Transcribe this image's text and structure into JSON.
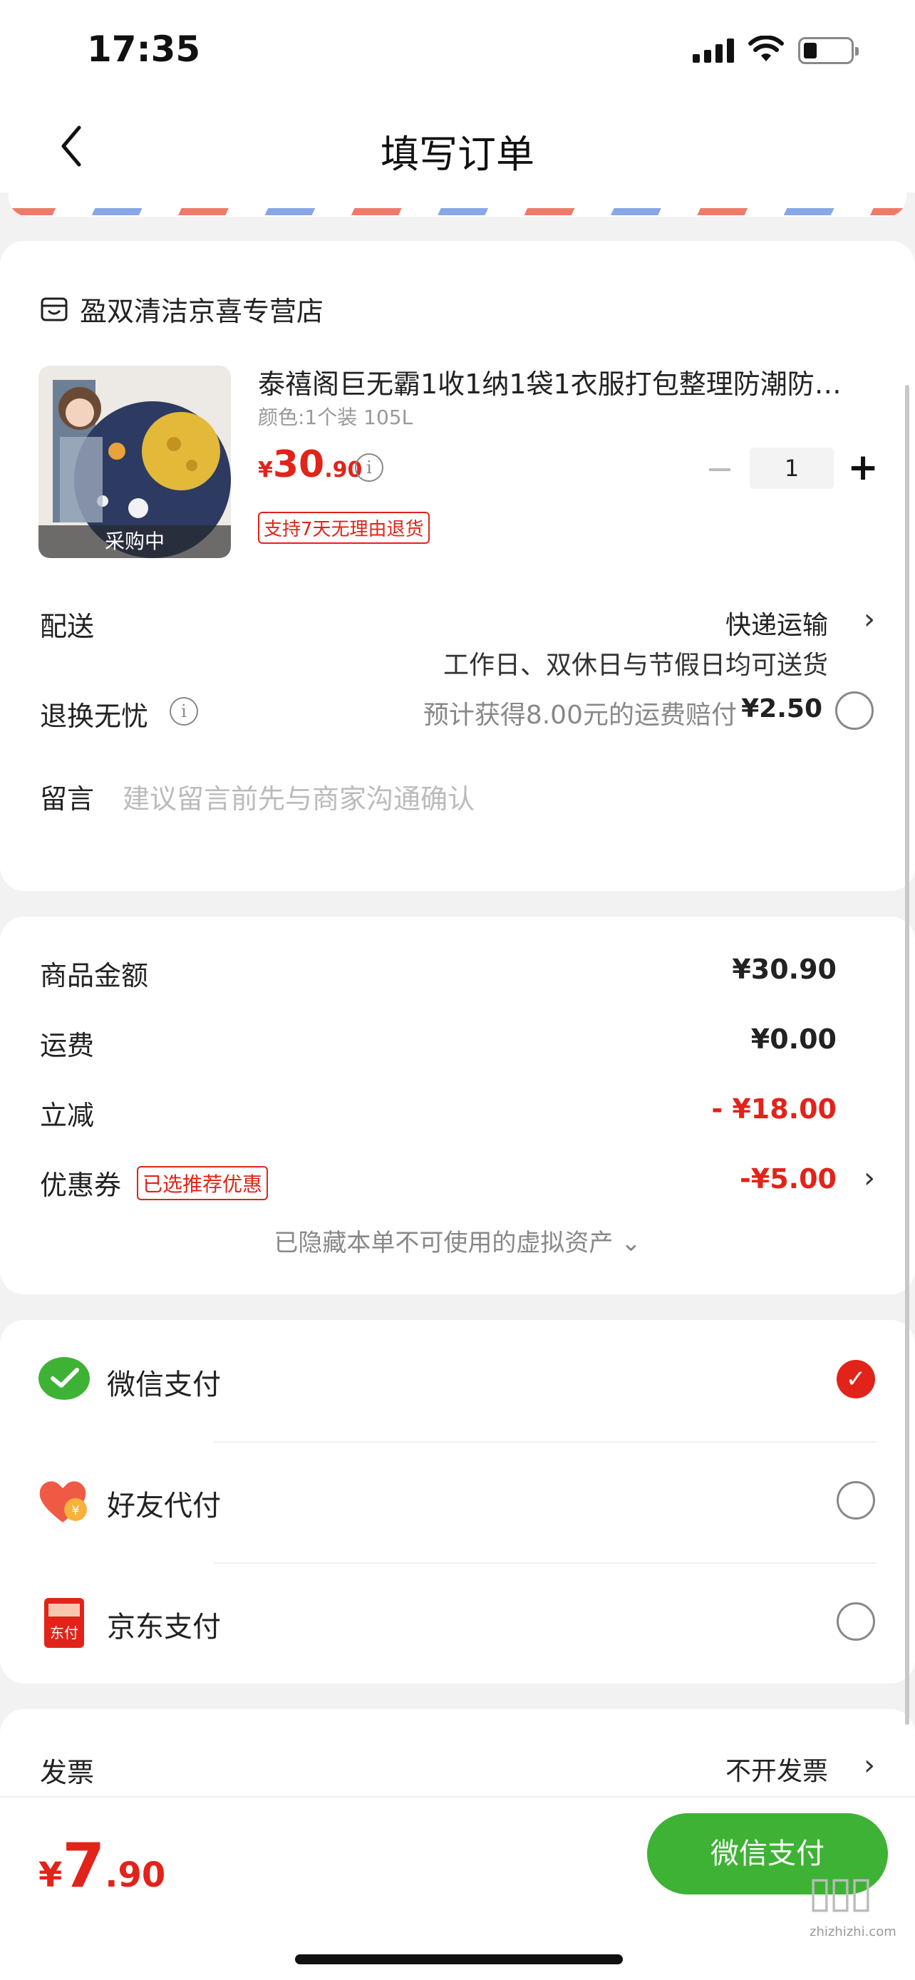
{
  "status_bar": {
    "time": "17:35"
  },
  "nav": {
    "title": "填写订单"
  },
  "shop": {
    "name": "盈双清洁京喜专营店"
  },
  "product": {
    "title": "泰禧阁巨无霸1收1纳1袋1衣服打包整理防潮防…",
    "sku": "颜色:1个装 105L",
    "price_currency": "¥",
    "price_int": "30",
    "price_dec": ".90",
    "thumb_tag": "采购中",
    "quantity": "1",
    "return_tag": "支持7天无理由退货"
  },
  "delivery": {
    "label": "配送",
    "method": "快递运输",
    "note": "工作日、双休日与节假日均可送货"
  },
  "worry_free": {
    "label": "退换无忧",
    "text": "预计获得8.00元的运费赔付",
    "price": "¥2.50"
  },
  "message": {
    "label": "留言",
    "placeholder": "建议留言前先与商家沟通确认"
  },
  "summary": {
    "goods_label": "商品金额",
    "goods_value": "¥30.90",
    "shipping_label": "运费",
    "shipping_value": "¥0.00",
    "discount_label": "立减",
    "discount_value": "- ¥18.00",
    "coupon_label": "优惠券",
    "coupon_tag": "已选推荐优惠",
    "coupon_value": "-¥5.00",
    "hidden_assets": "已隐藏本单不可使用的虚拟资产 ⌄"
  },
  "payment": {
    "wechat": "微信支付",
    "friend": "好友代付",
    "jd": "京东支付",
    "jd_icon_text": "东付",
    "friend_icon_text": "¥"
  },
  "invoice": {
    "label": "发票",
    "value": "不开发票"
  },
  "bottom": {
    "total_currency": "¥",
    "total_int": "7",
    "total_dec": ".90",
    "pay_button": "微信支付"
  },
  "watermark": {
    "text": "zhizhizhi.com"
  },
  "colors": {
    "accent_red": "#e2231a",
    "wechat_green": "#3eb235"
  }
}
